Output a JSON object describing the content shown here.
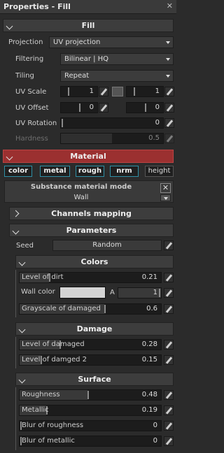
{
  "window": {
    "title": "Properties - Fill",
    "close": "✕"
  },
  "fill": {
    "header": "Fill",
    "projection": {
      "label": "Projection",
      "value": "UV projection"
    },
    "filtering": {
      "label": "Filtering",
      "value": "Bilinear | HQ"
    },
    "tiling": {
      "label": "Tiling",
      "value": "Repeat"
    },
    "uv_scale": {
      "label": "UV Scale",
      "value_1": "1",
      "value_2": "1"
    },
    "uv_offset": {
      "label": "UV Offset",
      "value_1": "0",
      "value_2": "0"
    },
    "uv_rotation": {
      "label": "UV Rotation",
      "value": "0"
    },
    "hardness": {
      "label": "Hardness",
      "value": "0.5"
    }
  },
  "material": {
    "header": "Material",
    "chips": [
      "color",
      "metal",
      "rough",
      "nrm",
      "height"
    ],
    "mode_title": "Substance material mode",
    "mode_value": "Wall",
    "channels_mapping": "Channels mapping",
    "parameters": "Parameters",
    "seed": {
      "label": "Seed",
      "value": "Random"
    },
    "colors": {
      "header": "Colors",
      "level_of_dirt": {
        "label": "Level of dirt",
        "value": "0.21"
      },
      "wall_color": {
        "label": "Wall color",
        "alpha_label": "A",
        "alpha_value": "1",
        "swatch": "#d4d4d4"
      },
      "grayscale_damaged": {
        "label": "Grayscale of damaged",
        "value": "0.6"
      }
    },
    "damage": {
      "header": "Damage",
      "level_of_damaged": {
        "label": "Level of damaged",
        "value": "0.28"
      },
      "level_of_damged_2": {
        "label": "Level of damged 2",
        "value": "0.15"
      }
    },
    "surface": {
      "header": "Surface",
      "roughness": {
        "label": "Roughness",
        "value": "0.48"
      },
      "metallic": {
        "label": "Metallic",
        "value": "0.19"
      },
      "blur_roughness": {
        "label": "Blur of roughness",
        "value": "0"
      },
      "blur_metallic": {
        "label": "Blur of metallic",
        "value": "0"
      }
    }
  },
  "colors": {
    "accent_red": "#9b3030",
    "chip_border": "#2f8fa5"
  }
}
